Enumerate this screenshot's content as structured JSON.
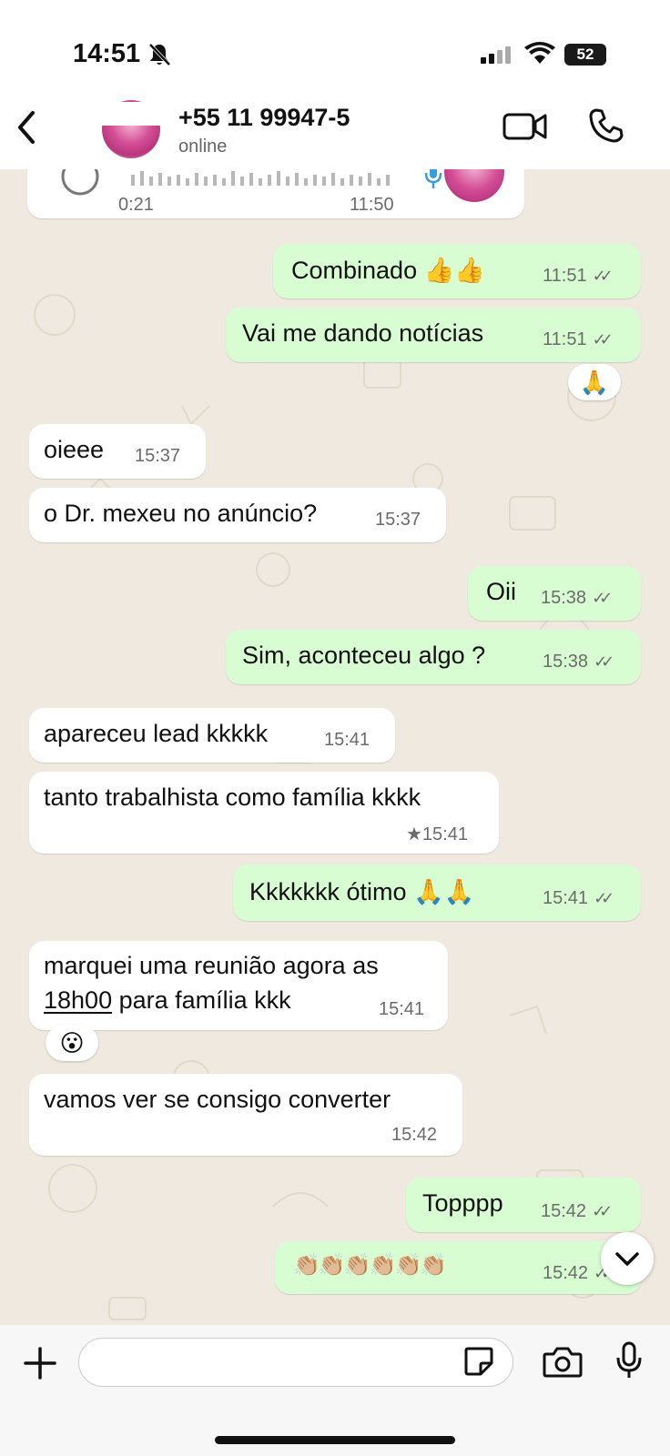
{
  "status_bar": {
    "time": "14:51",
    "battery": "52"
  },
  "header": {
    "contact": "+55 11 99947-5",
    "presence": "online"
  },
  "voice_note": {
    "duration": "0:21",
    "time": "11:50"
  },
  "messages": [
    {
      "dir": "out",
      "text": "Combinado 👍👍",
      "time": "11:51",
      "ticks": "✓✓"
    },
    {
      "dir": "out",
      "text": "Vai me dando notícias",
      "time": "11:51",
      "ticks": "✓✓",
      "reaction": "🙏"
    },
    {
      "dir": "in",
      "text": "oieee",
      "time": "15:37"
    },
    {
      "dir": "in",
      "text": "o Dr. mexeu no anúncio?",
      "time": "15:37"
    },
    {
      "dir": "out",
      "text": "Oii",
      "time": "15:38",
      "ticks": "✓✓"
    },
    {
      "dir": "out",
      "text": "Sim, aconteceu algo ?",
      "time": "15:38",
      "ticks": "✓✓"
    },
    {
      "dir": "in",
      "text": "apareceu lead kkkkk",
      "time": "15:41"
    },
    {
      "dir": "in",
      "text": "tanto trabalhista como família kkkk",
      "time": "★15:41"
    },
    {
      "dir": "out",
      "text": "Kkkkkkk ótimo 🙏🙏",
      "time": "15:41",
      "ticks": "✓✓"
    },
    {
      "dir": "in",
      "text_line1": "marquei uma reunião agora as",
      "text_line2_link": "18h00",
      "text_line2_rest": " para família kkk",
      "time": "15:41",
      "reaction": "😮"
    },
    {
      "dir": "in",
      "text": "vamos ver se consigo converter",
      "time": "15:42"
    },
    {
      "dir": "out",
      "text": "Topppp",
      "time": "15:42",
      "ticks": "✓✓"
    },
    {
      "dir": "out",
      "text": "👏🏼👏🏼👏🏼👏🏼👏🏼👏🏼",
      "time": "15:42",
      "ticks": "✓✓"
    }
  ],
  "composer": {
    "placeholder": ""
  },
  "colors": {
    "outgoing": "#d9fdd3",
    "incoming": "#ffffff",
    "wallpaper": "#efe9df"
  }
}
